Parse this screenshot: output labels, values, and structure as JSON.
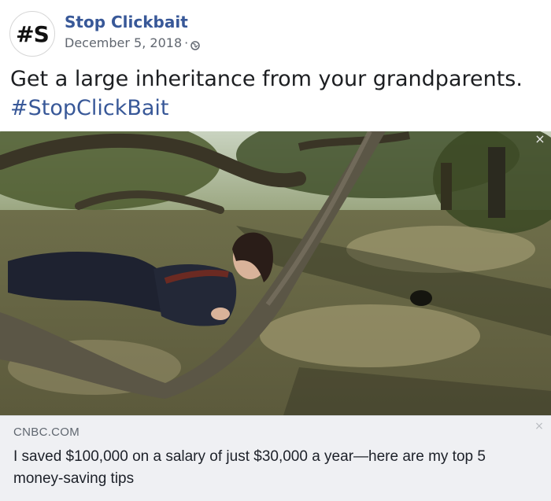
{
  "post": {
    "page_name": "Stop Clickbait",
    "avatar_text": "#S",
    "date": "December 5, 2018",
    "separator": "·",
    "privacy_icon": "globe-icon",
    "caption_text": "Get a large inheritance from your grandparents.",
    "caption_hashtag": "#StopClickBait"
  },
  "photo": {
    "close_glyph": "×"
  },
  "link_preview": {
    "domain": "CNBC.COM",
    "title": "I saved $100,000 on a salary of just $30,000 a year—here are my top 5 money-saving tips",
    "close_glyph": "×"
  },
  "colors": {
    "link_blue": "#385898",
    "meta_gray": "#616770",
    "card_bg": "#eff0f3"
  }
}
